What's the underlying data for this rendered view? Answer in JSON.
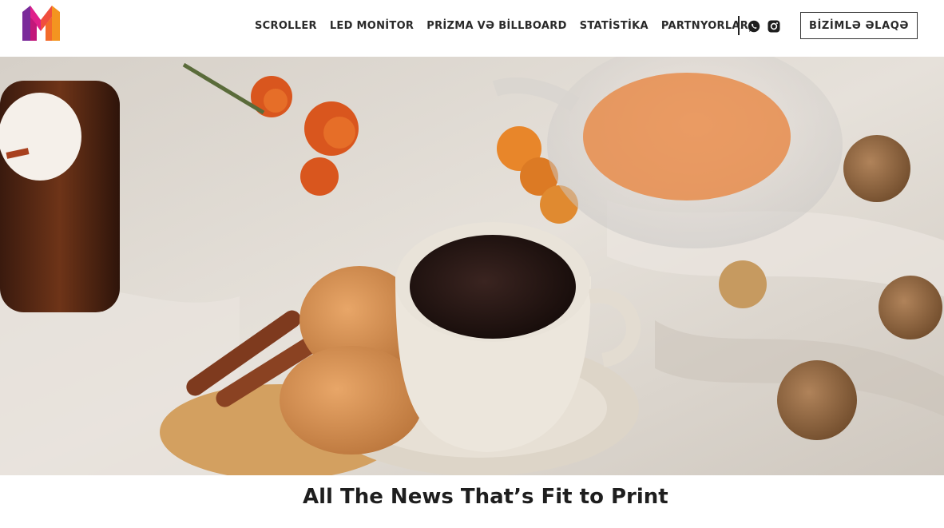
{
  "header": {
    "logo_icon": "m-logo-icon",
    "nav_items": [
      {
        "label": "SCROLLER"
      },
      {
        "label": "LED MONİTOR"
      },
      {
        "label": "PRİZMA VƏ BİLLBOARD"
      },
      {
        "label": "STATİSTİKA"
      },
      {
        "label": "PARTNYORLAR"
      }
    ],
    "social": [
      {
        "icon": "whatsapp-icon"
      },
      {
        "icon": "instagram-icon"
      }
    ],
    "contact_label": "BİZİMLƏ ƏLAQƏ"
  },
  "hero": {
    "image": "coffee-cookies-teapot-photo"
  },
  "main": {
    "headline": "All The News That’s Fit to Print"
  },
  "colors": {
    "logo_magenta": "#e0208a",
    "logo_orange": "#f39420",
    "logo_purple": "#7a2a9a",
    "text": "#2a2a2a"
  }
}
